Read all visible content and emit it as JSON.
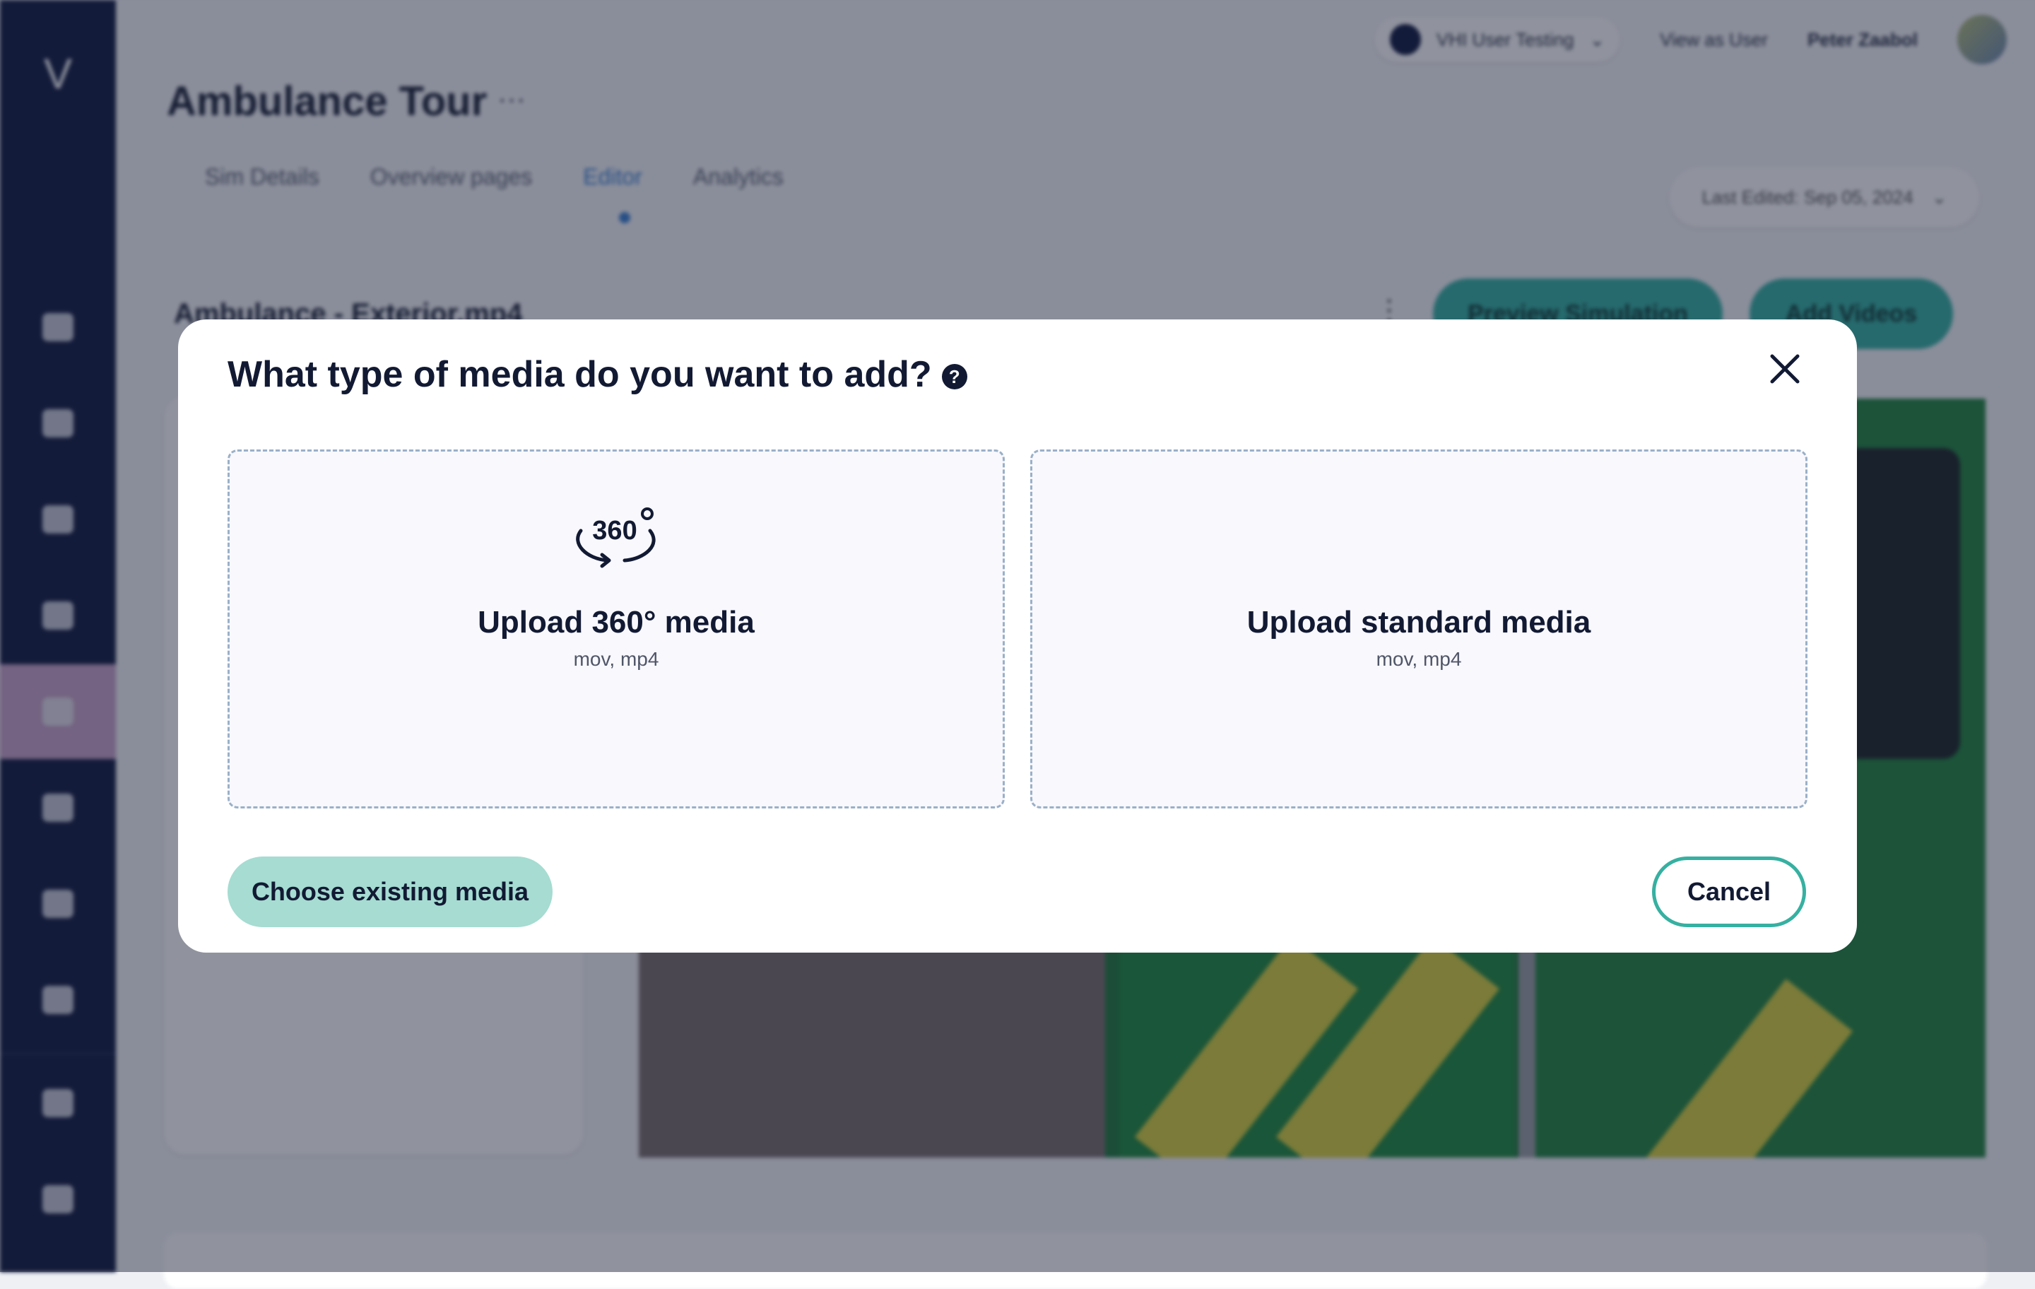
{
  "app": {
    "logo_text": "V",
    "topbar": {
      "workspace": "VHI User Testing",
      "view_as_user": "View as User",
      "user_name": "Peter Zaabol"
    },
    "page_title": "Ambulance Tour",
    "title_menu": "···",
    "tabs": [
      {
        "label": "Sim Details"
      },
      {
        "label": "Overview pages"
      },
      {
        "label": "Editor"
      },
      {
        "label": "Analytics"
      }
    ],
    "last_edited": "Last Edited: Sep 05, 2024",
    "scene_name": "Ambulance - Exterior.mp4",
    "scene_menu": "⋮",
    "preview_button": "Preview Simulation",
    "add_videos_button": "Add Videos"
  },
  "modal": {
    "title": "What type of media do you want to add?",
    "help_glyph": "?",
    "options": [
      {
        "title": "Upload 360° media",
        "formats": "mov, mp4",
        "icon": "360-icon",
        "icon_label": "360"
      },
      {
        "title": "Upload standard media",
        "formats": "mov, mp4"
      }
    ],
    "choose_existing_label": "Choose existing media",
    "cancel_label": "Cancel",
    "colors": {
      "primary_teal": "#36b0a1",
      "light_teal": "#a6dcd2",
      "navy": "#121a33",
      "dashed_border": "#9ab0c8"
    }
  }
}
